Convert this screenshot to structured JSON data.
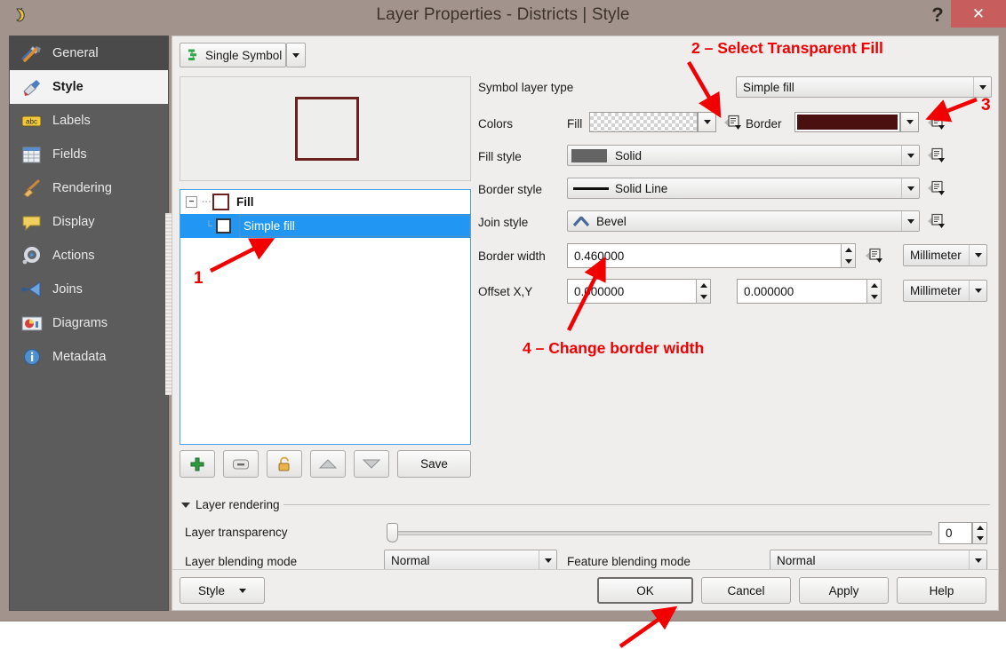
{
  "window": {
    "title": "Layer Properties - Districts | Style",
    "app_icon": "qgis-icon",
    "help_label": "?",
    "close_label": "✕"
  },
  "sidebar": {
    "items": [
      {
        "label": "General",
        "icon": "hammer-wrench-icon",
        "state": "hovered"
      },
      {
        "label": "Style",
        "icon": "paintbrush-icon",
        "state": "active"
      },
      {
        "label": "Labels",
        "icon": "abc-label-icon",
        "state": "normal"
      },
      {
        "label": "Fields",
        "icon": "table-grid-icon",
        "state": "normal"
      },
      {
        "label": "Rendering",
        "icon": "broom-icon",
        "state": "normal"
      },
      {
        "label": "Display",
        "icon": "speech-bubble-icon",
        "state": "normal"
      },
      {
        "label": "Actions",
        "icon": "gear-play-icon",
        "state": "normal"
      },
      {
        "label": "Joins",
        "icon": "join-arrow-icon",
        "state": "normal"
      },
      {
        "label": "Diagrams",
        "icon": "pie-chart-icon",
        "state": "normal"
      },
      {
        "label": "Metadata",
        "icon": "info-circle-icon",
        "state": "normal"
      }
    ]
  },
  "main": {
    "renderer": {
      "label": "Single Symbol",
      "icon": "single-symbol-icon"
    },
    "symbol_tree": {
      "root": {
        "label": "Fill",
        "swatch_border": "#6d2020",
        "expander": "−"
      },
      "child": {
        "label": "Simple fill",
        "swatch_border": "#33343a",
        "selected": true
      }
    },
    "tree_toolbar": {
      "add_label": "+",
      "remove_label": "–",
      "lock_label": "lock",
      "up_label": "▲",
      "down_label": "▼",
      "save_label": "Save"
    },
    "form": {
      "symbol_layer_type_label": "Symbol layer type",
      "symbol_layer_type_value": "Simple fill",
      "colors_label": "Colors",
      "fill_label": "Fill",
      "fill_value": "transparent-checker",
      "border_label": "Border",
      "border_color": "#4a0f0f",
      "fill_style_label": "Fill style",
      "fill_style_value": "Solid",
      "fill_style_swatch": "#646464",
      "border_style_label": "Border style",
      "border_style_value": "Solid Line",
      "join_style_label": "Join style",
      "join_style_value": "Bevel",
      "border_width_label": "Border width",
      "border_width_value": "0.460000",
      "border_width_unit": "Millimeter",
      "offset_label": "Offset X,Y",
      "offset_x_value": "0.000000",
      "offset_y_value": "0.000000",
      "offset_unit": "Millimeter"
    },
    "layer_rendering": {
      "group_label": "Layer rendering",
      "transparency_label": "Layer transparency",
      "transparency_value": "0",
      "layer_blending_label": "Layer blending mode",
      "layer_blending_value": "Normal",
      "feature_blending_label": "Feature blending mode",
      "feature_blending_value": "Normal"
    },
    "buttons": {
      "style_label": "Style",
      "ok_label": "OK",
      "cancel_label": "Cancel",
      "apply_label": "Apply",
      "help_label": "Help"
    }
  },
  "annotations": {
    "step1": "1",
    "step2": "2 – Select Transparent Fill",
    "step3": "3",
    "step4": "4 – Change border width",
    "color": "#f20000"
  }
}
